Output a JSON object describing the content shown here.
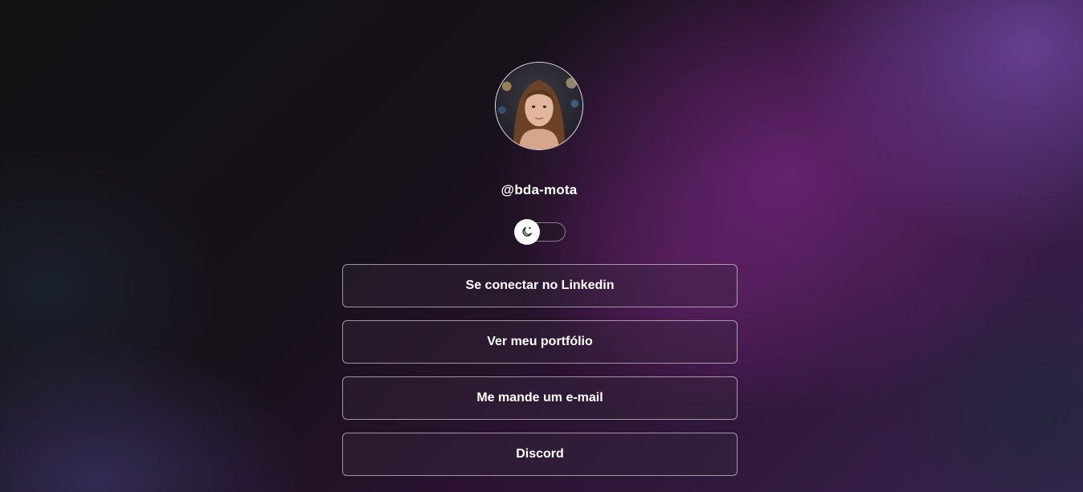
{
  "profile": {
    "avatar_alt": "profile photo",
    "username": "@bda-mota"
  },
  "theme_toggle": {
    "icon": "moon-icon",
    "state": "dark"
  },
  "links": [
    {
      "label": "Se conectar no Linkedin"
    },
    {
      "label": "Ver meu portfólio"
    },
    {
      "label": "Me mande um e-mail"
    },
    {
      "label": "Discord"
    }
  ],
  "colors": {
    "accent_purple": "#5e2a6e",
    "background_dark": "#141217",
    "button_border": "#e0d8e4"
  }
}
